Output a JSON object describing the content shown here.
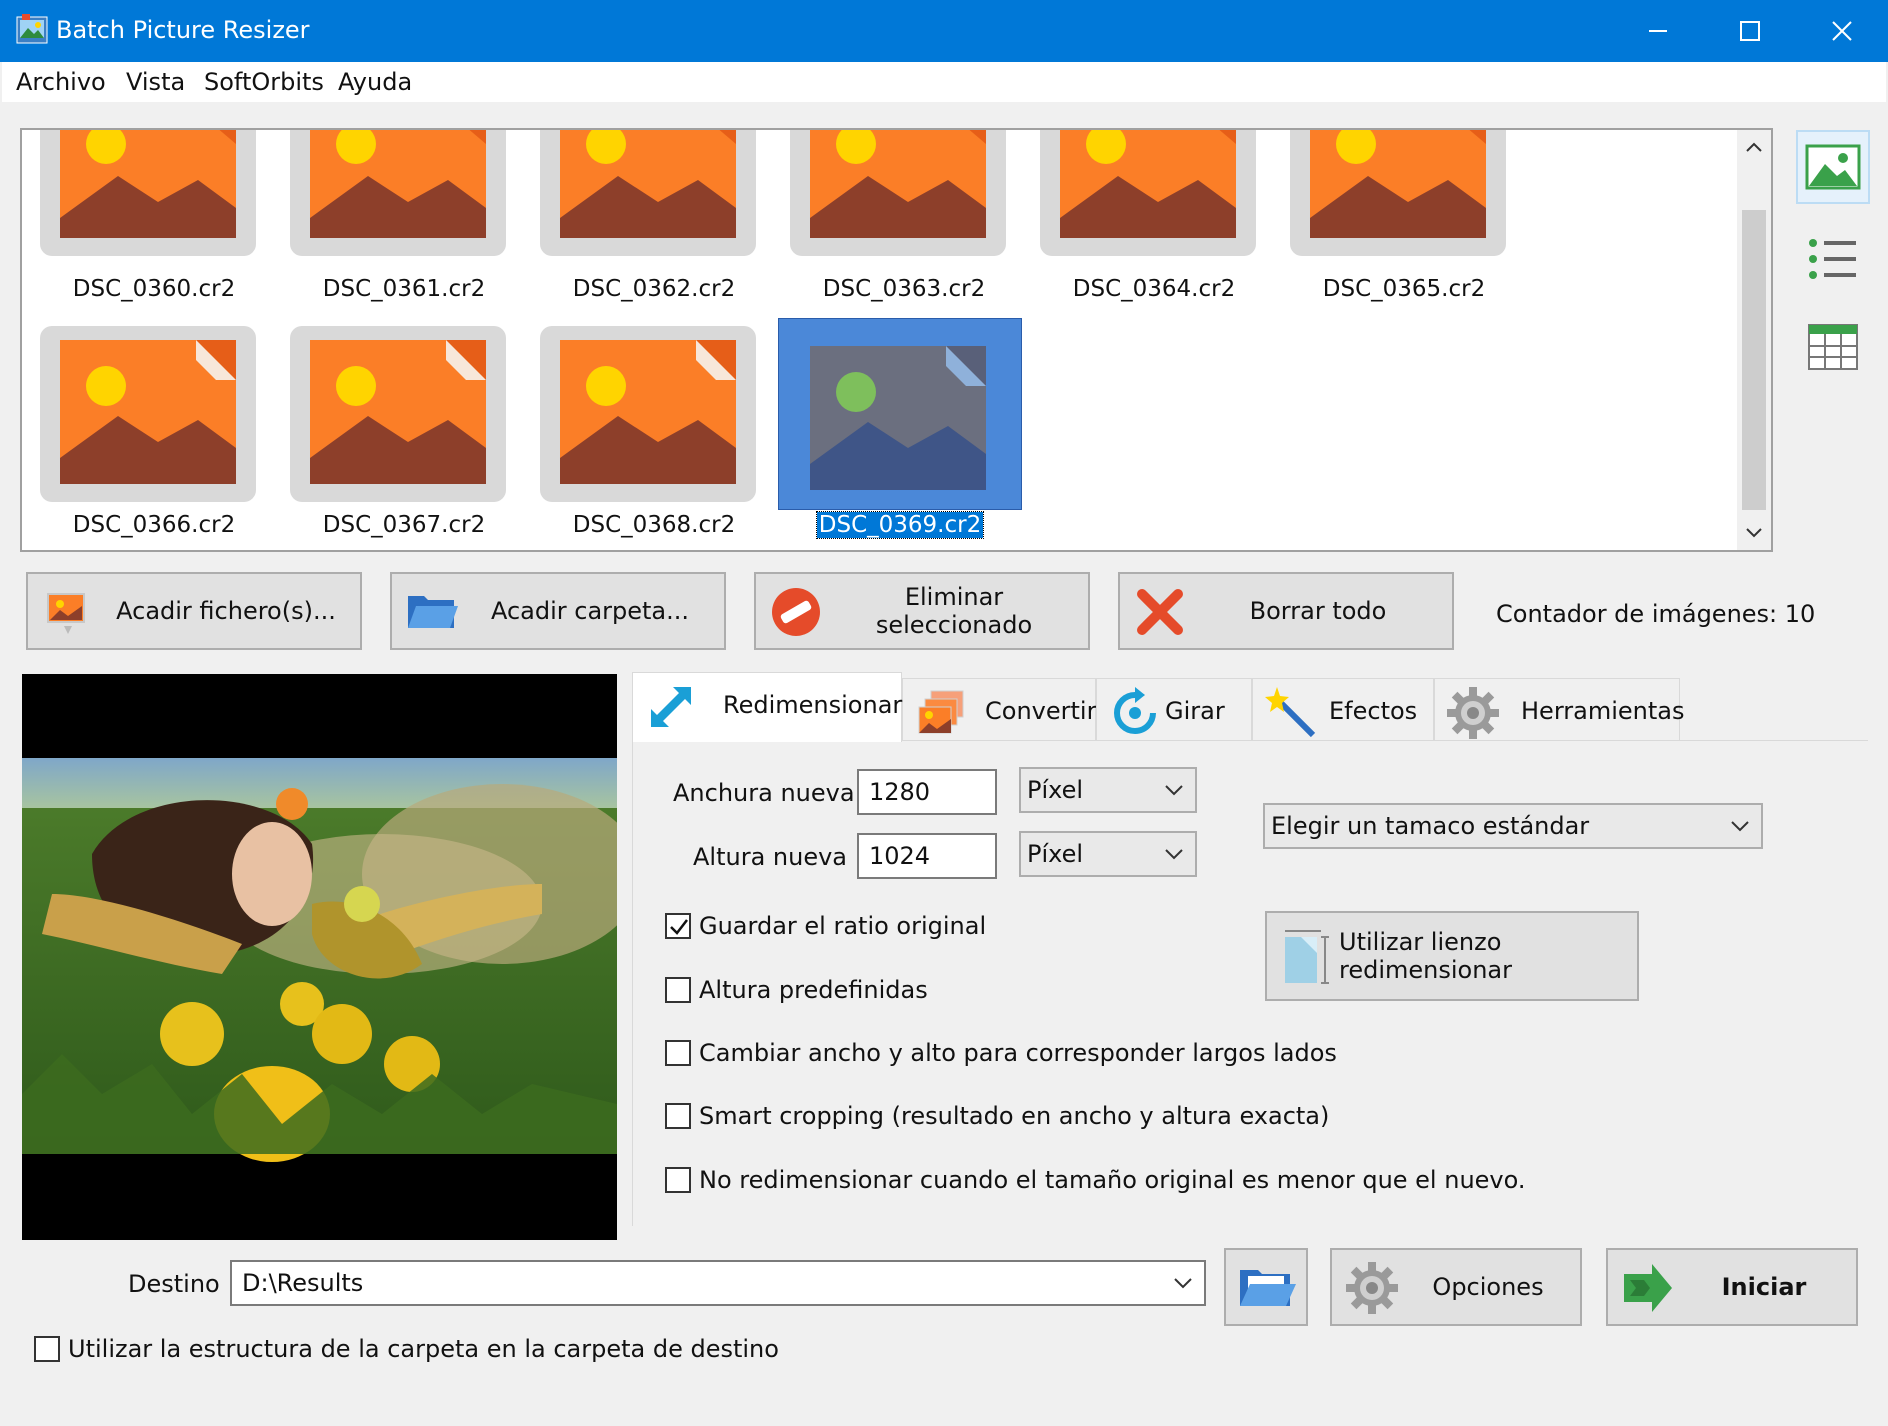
{
  "window": {
    "title": "Batch Picture Resizer"
  },
  "menu": [
    "Archivo",
    "Vista",
    "SoftOrbits",
    "Ayuda"
  ],
  "files": [
    {
      "name": "DSC_0360.cr2"
    },
    {
      "name": "DSC_0361.cr2"
    },
    {
      "name": "DSC_0362.cr2"
    },
    {
      "name": "DSC_0363.cr2"
    },
    {
      "name": "DSC_0364.cr2"
    },
    {
      "name": "DSC_0365.cr2"
    },
    {
      "name": "DSC_0366.cr2"
    },
    {
      "name": "DSC_0367.cr2"
    },
    {
      "name": "DSC_0368.cr2"
    },
    {
      "name": "DSC_0369.cr2",
      "selected": true
    }
  ],
  "actions": {
    "add_files": "Acadir fichero(s)...",
    "add_folder": "Acadir carpeta...",
    "remove_selected": "Eliminar seleccionado",
    "clear_all": "Borrar todo"
  },
  "counter": "Contador de imágenes: 10",
  "tabs": [
    "Redimensionar",
    "Convertir",
    "Girar",
    "Efectos",
    "Herramientas"
  ],
  "resize": {
    "width_label": "Anchura nueva",
    "width_value": "1280",
    "width_unit": "Píxel",
    "height_label": "Altura nueva",
    "height_value": "1024",
    "height_unit": "Píxel",
    "standard_size": "Elegir un tamaco estándar",
    "canvas_button": "Utilizar lienzo redimensionar",
    "options": [
      {
        "label": "Guardar el ratio original",
        "checked": true
      },
      {
        "label": "Altura predefinidas",
        "checked": false
      },
      {
        "label": "Cambiar ancho y alto para corresponder largos lados",
        "checked": false
      },
      {
        "label": "Smart cropping (resultado en ancho y altura exacta)",
        "checked": false
      },
      {
        "label": "No redimensionar cuando el tamaño original es menor que el nuevo.",
        "checked": false
      }
    ]
  },
  "destination": {
    "label": "Destino",
    "value": "D:\\Results",
    "options_button": "Opciones",
    "start_button": "Iniciar",
    "keep_structure": "Utilizar la estructura de la carpeta en la carpeta de destino",
    "keep_structure_checked": false
  },
  "colors": {
    "titlebar": "#0078d7",
    "selection": "#0078d7",
    "placeholder_orange": "#fb7e27",
    "placeholder_brown": "#8d3f2a",
    "placeholder_sun": "#ffd400"
  }
}
